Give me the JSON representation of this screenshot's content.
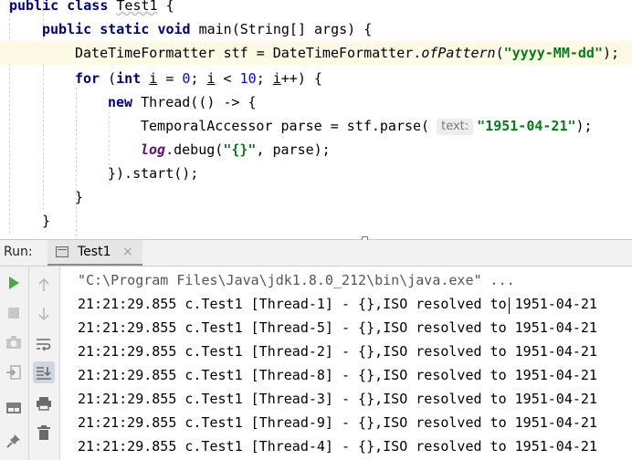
{
  "editor": {
    "lines": {
      "l1": {
        "kw1": "public",
        "kw2": "class",
        "name": "Test1",
        "brace": "{"
      },
      "l2": {
        "kw1": "public",
        "kw2": "static",
        "kw3": "void",
        "rest": "main(String[] args) {"
      },
      "l3": {
        "type": "DateTimeFormatter",
        "var": "stf",
        "eq": "=",
        "cls": "DateTimeFormatter.",
        "method": "ofPattern",
        "open": "(",
        "pattern": "\"yyyy-MM-dd\"",
        "close": ");"
      },
      "l4": {
        "kw": "for",
        "open": " (",
        "kw_int": "int",
        "var1": "i",
        "eq": " = ",
        "zero": "0",
        "sep1": "; ",
        "var2": "i",
        "lt": " < ",
        "ten": "10",
        "sep2": "; ",
        "var3": "i",
        "rest": "++) {"
      },
      "l5": {
        "kw": "new",
        "rest": "Thread(() -> {"
      },
      "l6": {
        "type": "TemporalAccessor",
        "var": "parse",
        "eq": "=",
        "call": "stf.parse(",
        "hint": "text:",
        "arg": "\"1951-04-21\"",
        "close": ");"
      },
      "l7": {
        "field": "log",
        "call": ".debug(",
        "arg": "\"{}\"",
        "rest": ", parse);"
      },
      "l8": {
        "text": "}).start();"
      },
      "l9": {
        "text": "}"
      },
      "l10": {
        "text": "}"
      }
    }
  },
  "run_panel": {
    "label": "Run:",
    "tab": {
      "label": "Test1",
      "close": "×"
    }
  },
  "console": {
    "command": "\"C:\\Program Files\\Java\\jdk1.8.0_212\\bin\\java.exe\" ...",
    "lines": [
      "21:21:29.855 c.Test1 [Thread-1] - {},ISO resolved to 1951-04-21",
      "21:21:29.855 c.Test1 [Thread-5] - {},ISO resolved to 1951-04-21",
      "21:21:29.855 c.Test1 [Thread-2] - {},ISO resolved to 1951-04-21",
      "21:21:29.855 c.Test1 [Thread-8] - {},ISO resolved to 1951-04-21",
      "21:21:29.855 c.Test1 [Thread-3] - {},ISO resolved to 1951-04-21",
      "21:21:29.855 c.Test1 [Thread-9] - {},ISO resolved to 1951-04-21",
      "21:21:29.855 c.Test1 [Thread-4] - {},ISO resolved to 1951-04-21"
    ]
  },
  "icons": {
    "left_toolbar": [
      "rerun-icon",
      "stop-icon",
      "camera-icon",
      "login-icon",
      "layout-icon",
      "pin-icon"
    ],
    "side_toolbar": [
      "arrow-up-icon",
      "arrow-down-icon",
      "soft-wrap-icon",
      "scroll-to-end-icon",
      "print-icon",
      "trash-icon"
    ]
  },
  "colors": {
    "keyword": "#000080",
    "number": "#0000ff",
    "string": "#067d17",
    "field": "#660e7a",
    "current_line": "#fcfae5",
    "run_green": "#4aa44a"
  }
}
